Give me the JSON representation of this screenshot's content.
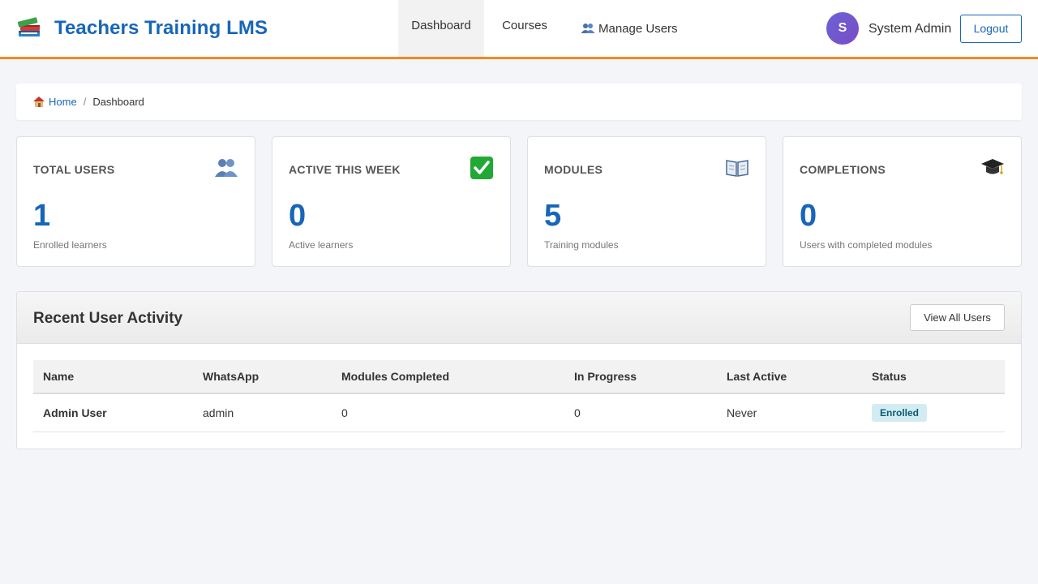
{
  "header": {
    "brand": "Teachers Training LMS",
    "nav": [
      {
        "label": "Dashboard",
        "active": true
      },
      {
        "label": "Courses",
        "active": false
      },
      {
        "label": "Manage Users",
        "active": false,
        "icon": "users-icon"
      }
    ],
    "user": {
      "initial": "S",
      "name": "System Admin"
    },
    "logout_label": "Logout",
    "accent_color": "#f08a24"
  },
  "breadcrumb": {
    "home": "Home",
    "separator": "/",
    "current": "Dashboard"
  },
  "stats": [
    {
      "label": "TOTAL USERS",
      "value": "1",
      "sub": "Enrolled learners",
      "icon": "users-icon"
    },
    {
      "label": "ACTIVE THIS WEEK",
      "value": "0",
      "sub": "Active learners",
      "icon": "check-icon"
    },
    {
      "label": "MODULES",
      "value": "5",
      "sub": "Training modules",
      "icon": "book-icon"
    },
    {
      "label": "COMPLETIONS",
      "value": "0",
      "sub": "Users with completed modules",
      "icon": "graduation-cap-icon"
    }
  ],
  "activity": {
    "title": "Recent User Activity",
    "view_all_label": "View All Users",
    "columns": [
      "Name",
      "WhatsApp",
      "Modules Completed",
      "In Progress",
      "Last Active",
      "Status"
    ],
    "rows": [
      {
        "name": "Admin User",
        "whatsapp": "admin",
        "completed": "0",
        "in_progress": "0",
        "last_active": "Never",
        "status": "Enrolled"
      }
    ]
  }
}
